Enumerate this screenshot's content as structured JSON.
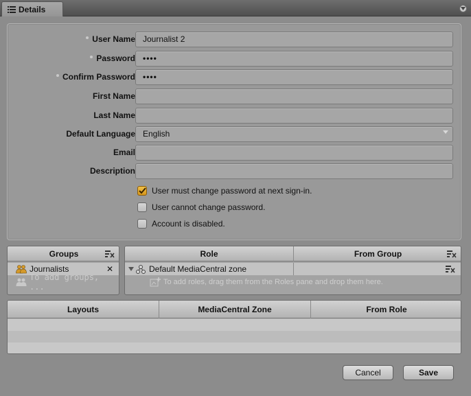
{
  "tab": {
    "label": "Details"
  },
  "form": {
    "user_name": {
      "label": "User Name:",
      "value": "Journalist 2"
    },
    "password": {
      "label": "Password:",
      "value": "••••"
    },
    "confirm_password": {
      "label": "Confirm Password:",
      "value": "••••"
    },
    "first_name": {
      "label": "First Name:",
      "value": ""
    },
    "last_name": {
      "label": "Last Name:",
      "value": ""
    },
    "default_language": {
      "label": "Default Language:",
      "value": "English"
    },
    "email": {
      "label": "Email:",
      "value": ""
    },
    "description": {
      "label": "Description:",
      "value": ""
    },
    "checkboxes": [
      {
        "label": "User must change password at next sign-in.",
        "checked": true
      },
      {
        "label": "User cannot change password.",
        "checked": false
      },
      {
        "label": "Account is disabled.",
        "checked": false
      }
    ]
  },
  "groups": {
    "header": "Groups",
    "items": [
      {
        "label": "Journalists"
      }
    ],
    "hint": "To add groups, ..."
  },
  "roles": {
    "headers": [
      "Role",
      "From Group"
    ],
    "items": [
      {
        "label": "Default MediaCentral zone"
      }
    ],
    "hint": "To add roles, drag them from the Roles pane and drop them here."
  },
  "layouts": {
    "headers": [
      "Layouts",
      "MediaCentral Zone",
      "From Role"
    ]
  },
  "buttons": {
    "cancel": "Cancel",
    "save": "Save"
  },
  "colors": {
    "accent_check": "#e0a22a",
    "panel": "#999999"
  }
}
